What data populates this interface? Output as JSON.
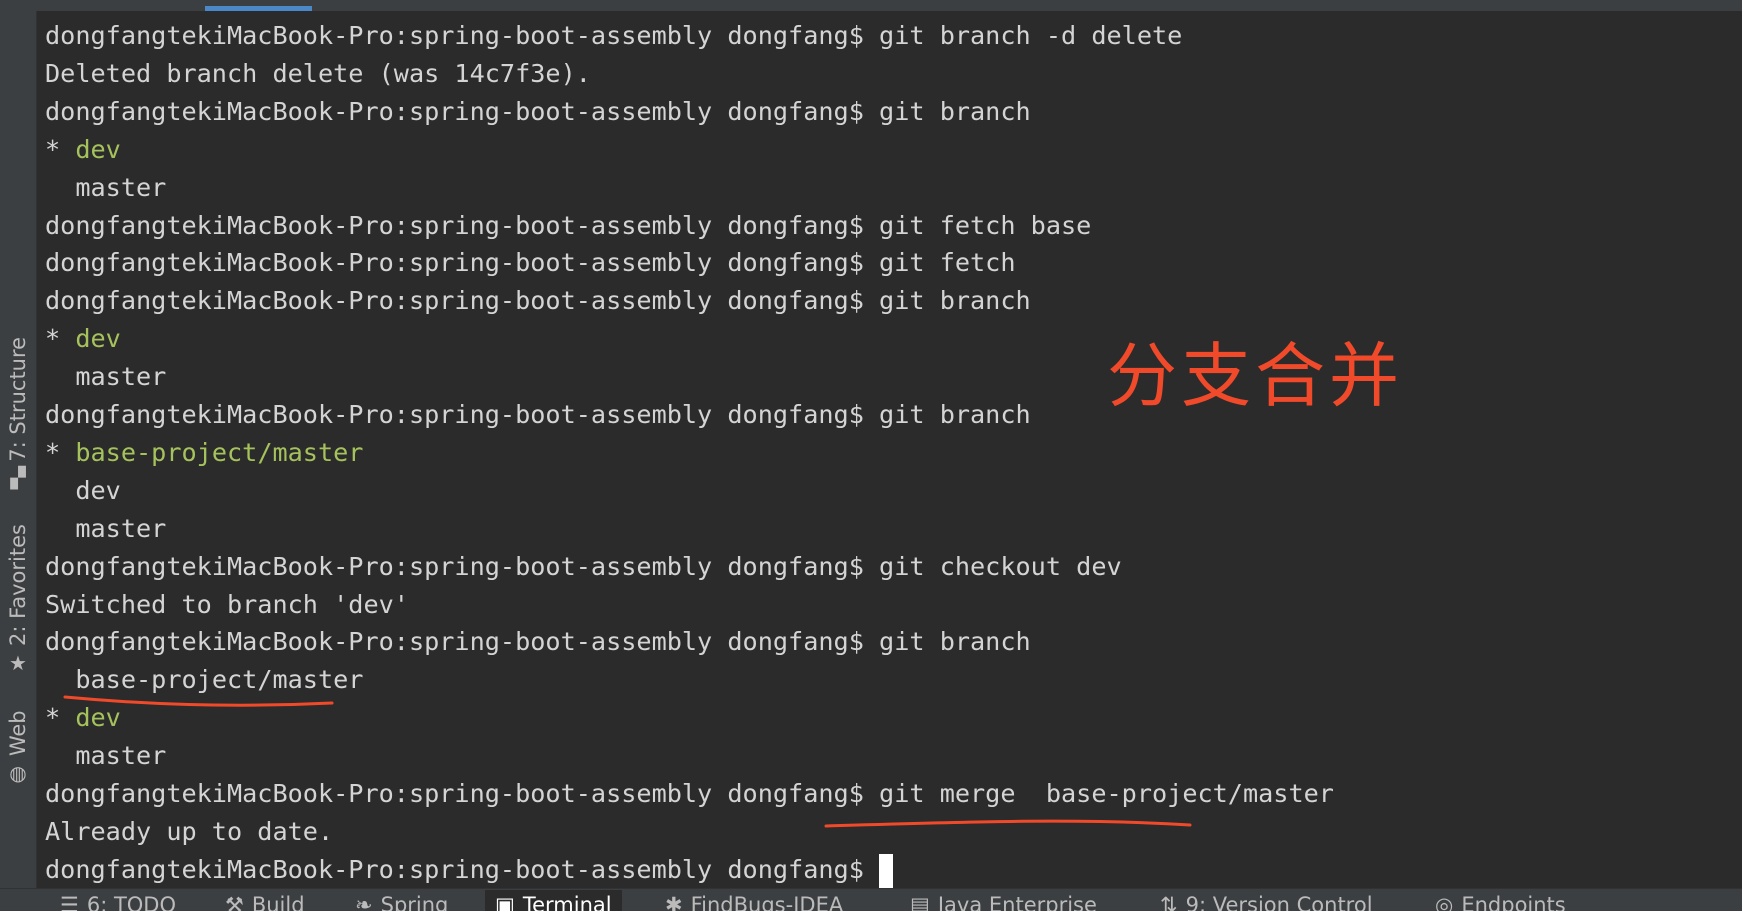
{
  "left_tool_windows": [
    {
      "label": "7: Structure",
      "icon": "structure-icon"
    },
    {
      "label": "2: Favorites",
      "icon": "star-icon"
    },
    {
      "label": "Web",
      "icon": "globe-icon"
    }
  ],
  "terminal": {
    "lines": [
      {
        "prefix": "dongfangtekiMacBook-Pro:spring-boot-assembly dongfang$ ",
        "text": "git branch -d delete"
      },
      {
        "prefix": "",
        "text": "Deleted branch delete (was 14c7f3e)."
      },
      {
        "prefix": "dongfangtekiMacBook-Pro:spring-boot-assembly dongfang$ ",
        "text": "git branch"
      },
      {
        "prefix": "* ",
        "text": "dev",
        "current": true
      },
      {
        "prefix": "  ",
        "text": "master"
      },
      {
        "prefix": "dongfangtekiMacBook-Pro:spring-boot-assembly dongfang$ ",
        "text": "git fetch base"
      },
      {
        "prefix": "dongfangtekiMacBook-Pro:spring-boot-assembly dongfang$ ",
        "text": "git fetch"
      },
      {
        "prefix": "dongfangtekiMacBook-Pro:spring-boot-assembly dongfang$ ",
        "text": "git branch"
      },
      {
        "prefix": "* ",
        "text": "dev",
        "current": true
      },
      {
        "prefix": "  ",
        "text": "master"
      },
      {
        "prefix": "dongfangtekiMacBook-Pro:spring-boot-assembly dongfang$ ",
        "text": "git branch"
      },
      {
        "prefix": "* ",
        "text": "base-project/master",
        "current": true
      },
      {
        "prefix": "  ",
        "text": "dev"
      },
      {
        "prefix": "  ",
        "text": "master"
      },
      {
        "prefix": "dongfangtekiMacBook-Pro:spring-boot-assembly dongfang$ ",
        "text": "git checkout dev"
      },
      {
        "prefix": "",
        "text": "Switched to branch 'dev'"
      },
      {
        "prefix": "dongfangtekiMacBook-Pro:spring-boot-assembly dongfang$ ",
        "text": "git branch"
      },
      {
        "prefix": "  ",
        "text": "base-project/master"
      },
      {
        "prefix": "* ",
        "text": "dev",
        "current": true
      },
      {
        "prefix": "  ",
        "text": "master"
      },
      {
        "prefix": "dongfangtekiMacBook-Pro:spring-boot-assembly dongfang$ ",
        "text": "git merge  base-project/master"
      },
      {
        "prefix": "",
        "text": "Already up to date."
      },
      {
        "prefix": "dongfangtekiMacBook-Pro:spring-boot-assembly dongfang$ ",
        "text": "",
        "cursor": true
      }
    ]
  },
  "annotation": {
    "text": "分支合并",
    "color": "#f04a2a"
  },
  "bottom_tool_windows": [
    {
      "label": "6: TODO",
      "icon": "list-icon"
    },
    {
      "label": "Build",
      "icon": "hammer-icon"
    },
    {
      "label": "Spring",
      "icon": "leaf-icon"
    },
    {
      "label": "Terminal",
      "icon": "terminal-icon",
      "active": true
    },
    {
      "label": "FindBugs-IDEA",
      "icon": "bug-icon"
    },
    {
      "label": "Java Enterprise",
      "icon": "window-icon"
    },
    {
      "label": "9: Version Control",
      "icon": "vcs-icon"
    },
    {
      "label": "Endpoints",
      "icon": "endpoints-icon"
    }
  ],
  "colors": {
    "background": "#2b2b2b",
    "text": "#d4d4d4",
    "current_branch": "#a5c25c",
    "tool_panel": "#3c3f41",
    "active_tab_accent": "#4a88c7",
    "annotation": "#f04a2a"
  }
}
